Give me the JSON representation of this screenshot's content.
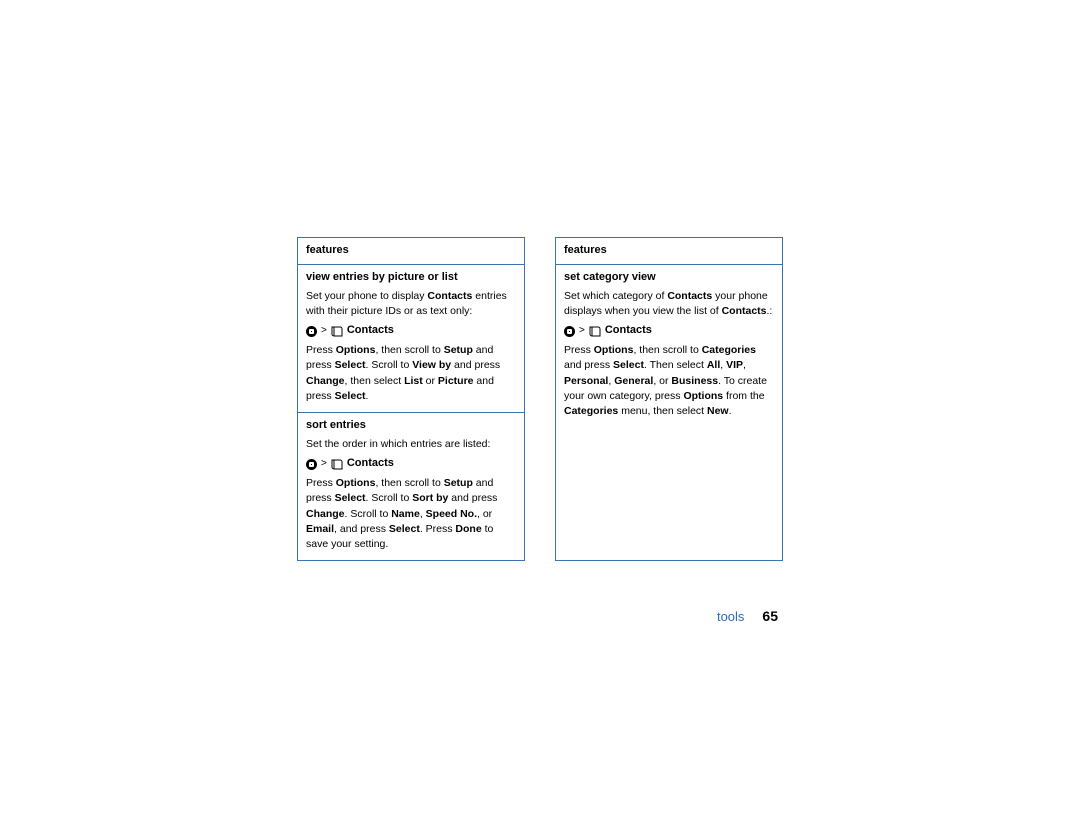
{
  "left": {
    "header": "features",
    "s1": {
      "title": "view entries by picture or list",
      "p1a": "Set your phone to display ",
      "p1b": "Contacts",
      "p1c": " entries with their picture IDs or as text only:",
      "nav": "Contacts",
      "p2a": "Press ",
      "p2b": "Options",
      "p2c": ", then scroll to ",
      "p2d": "Setup",
      "p2e": " and press ",
      "p2f": "Select",
      "p2g": ". Scroll to ",
      "p2h": "View by",
      "p2i": " and press ",
      "p2j": "Change",
      "p2k": ", then select ",
      "p2l": "List",
      "p2m": " or ",
      "p2n": "Picture",
      "p2o": " and press ",
      "p2p": "Select",
      "p2q": "."
    },
    "s2": {
      "title": "sort entries",
      "p1": "Set the order in which entries are listed:",
      "nav": "Contacts",
      "p2a": "Press ",
      "p2b": "Options",
      "p2c": ", then scroll to ",
      "p2d": "Setup",
      "p2e": " and press ",
      "p2f": "Select",
      "p2g": ". Scroll to ",
      "p2h": "Sort by",
      "p2i": " and press ",
      "p2j": "Change",
      "p2k": ". Scroll to ",
      "p2l": "Name",
      "p2m": ", ",
      "p2n": "Speed No.",
      "p2o": ", or ",
      "p2p": "Email",
      "p2q": ", and press ",
      "p2r": "Select",
      "p2s": ". Press ",
      "p2t": "Done",
      "p2u": " to save your setting."
    }
  },
  "right": {
    "header": "features",
    "s1": {
      "title": "set category view",
      "p1a": "Set which category of ",
      "p1b": "Contacts",
      "p1c": " your phone displays when you view the list of ",
      "p1d": "Contacts",
      "p1e": ".:",
      "nav": "Contacts",
      "p2a": "Press ",
      "p2b": "Options",
      "p2c": ", then scroll to ",
      "p2d": "Categories",
      "p2e": " and press ",
      "p2f": "Select",
      "p2g": ". Then select ",
      "p2h": "All",
      "p2i": ", ",
      "p2j": "VIP",
      "p2k": ", ",
      "p2l": "Personal",
      "p2m": ", ",
      "p2n": "General",
      "p2o": ", or ",
      "p2p": "Business",
      "p2q": ". To create your own category, press ",
      "p2r": "Options",
      "p2s": " from the ",
      "p2t": "Categories",
      "p2u": " menu, then select ",
      "p2v": "New",
      "p2w": "."
    }
  },
  "footer": {
    "section": "tools",
    "page": "65"
  }
}
